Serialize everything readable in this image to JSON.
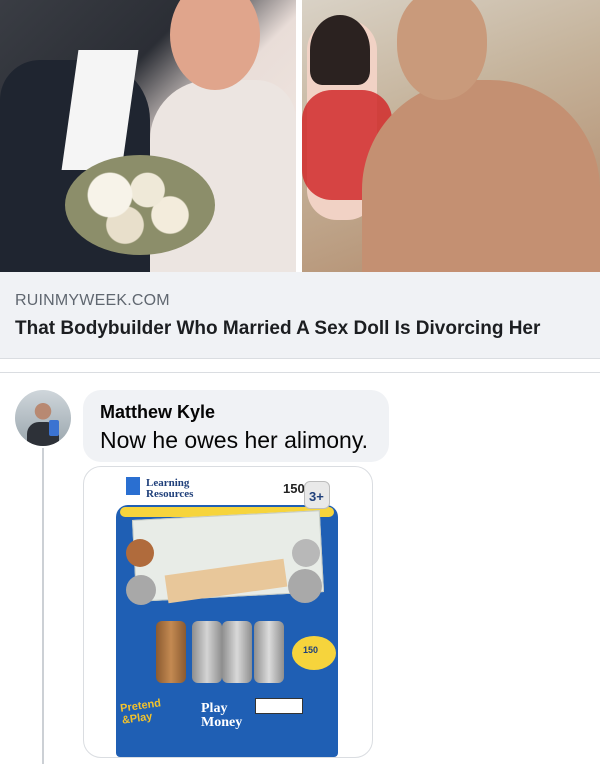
{
  "link_preview": {
    "domain": "RUINMYWEEK.COM",
    "title": "That Bodybuilder Who Married A Sex Doll Is Divorcing Her"
  },
  "comment": {
    "author": "Matthew Kyle",
    "text": "Now he owes her alimony."
  },
  "product_image": {
    "brand_line1": "Learning",
    "brand_line2": "Resources",
    "count": "150",
    "age": "3+",
    "title_line1": "Play",
    "title_line2": "Money",
    "sub_brand_line1": "Pretend",
    "sub_brand_line2": "&Play",
    "badge_count": "150"
  },
  "colors": {
    "link_card_bg": "#f0f2f5",
    "bubble_bg": "#f0f2f5",
    "package_blue": "#1f5fb4",
    "package_yellow": "#f6d43c"
  }
}
